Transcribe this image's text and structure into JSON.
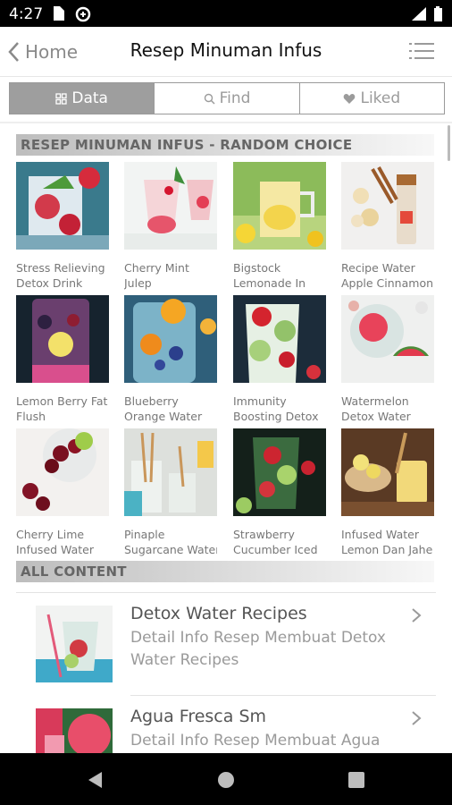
{
  "status_bar": {
    "time": "4:27"
  },
  "header": {
    "back_label": "Home",
    "title": "Resep Minuman Infus"
  },
  "segments": [
    {
      "label": "Data",
      "icon": "grid-icon",
      "active": true
    },
    {
      "label": "Find",
      "icon": "search-icon",
      "active": false
    },
    {
      "label": "Liked",
      "icon": "heart-icon",
      "active": false
    }
  ],
  "random_section": {
    "title": "RESEP MINUMAN INFUS - RANDOM CHOICE",
    "items": [
      {
        "line1": "Stress Relieving",
        "line2": "Detox Drink"
      },
      {
        "line1": "Cherry Mint",
        "line2": "Julep"
      },
      {
        "line1": "Bigstock",
        "line2": "Lemonade In"
      },
      {
        "line1": "Recipe Water",
        "line2": "Apple Cinnamon"
      },
      {
        "line1": "Lemon Berry Fat",
        "line2": "Flush"
      },
      {
        "line1": "Blueberry",
        "line2": "Orange Water"
      },
      {
        "line1": "Immunity",
        "line2": "Boosting Detox"
      },
      {
        "line1": "Watermelon",
        "line2": "Detox Water"
      },
      {
        "line1": "Cherry Lime",
        "line2": "Infused Water"
      },
      {
        "line1": "Pinaple",
        "line2": "Sugarcane Water"
      },
      {
        "line1": "Strawberry",
        "line2": "Cucumber Iced"
      },
      {
        "line1": "Infused Water",
        "line2": "Lemon Dan Jahe"
      }
    ]
  },
  "all_content": {
    "title": "ALL CONTENT",
    "items": [
      {
        "title": "Detox Water Recipes",
        "description": "Detail Info Resep Membuat Detox Water Recipes"
      },
      {
        "title": "Agua Fresca Sm",
        "description": "Detail Info Resep Membuat Agua"
      }
    ]
  },
  "colors": {
    "active_segment": "#9e9e9e",
    "section_bar": "#bdbdbd",
    "status_bar": "#000000"
  }
}
